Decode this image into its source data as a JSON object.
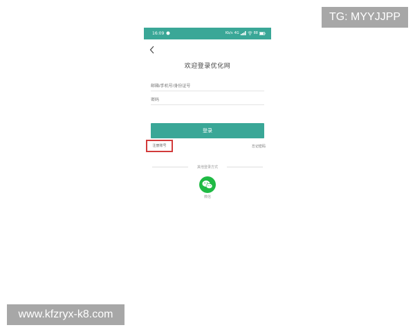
{
  "status_bar": {
    "time": "16:09",
    "right_text": "Kb/s",
    "network": "4G",
    "battery_pct": "88"
  },
  "header": {
    "title": "欢迎登录优化网"
  },
  "form": {
    "account_placeholder": "邮箱/手机号/身份证号",
    "password_placeholder": "密码",
    "login_label": "登录"
  },
  "links": {
    "register": "注册账号",
    "forgot_password": "忘记密码"
  },
  "other_login": {
    "label": "其他登录方式",
    "wechat_label": "微信"
  },
  "watermarks": {
    "top_right": "TG: MYYJJPP",
    "bottom_left": "www.kfzryx-k8.com"
  },
  "colors": {
    "primary": "#3aa797",
    "highlight": "#d23a3a",
    "wechat": "#1fba44"
  },
  "icons": [
    "back-icon",
    "wechat-icon",
    "signal-icon",
    "wifi-icon",
    "battery-icon"
  ]
}
